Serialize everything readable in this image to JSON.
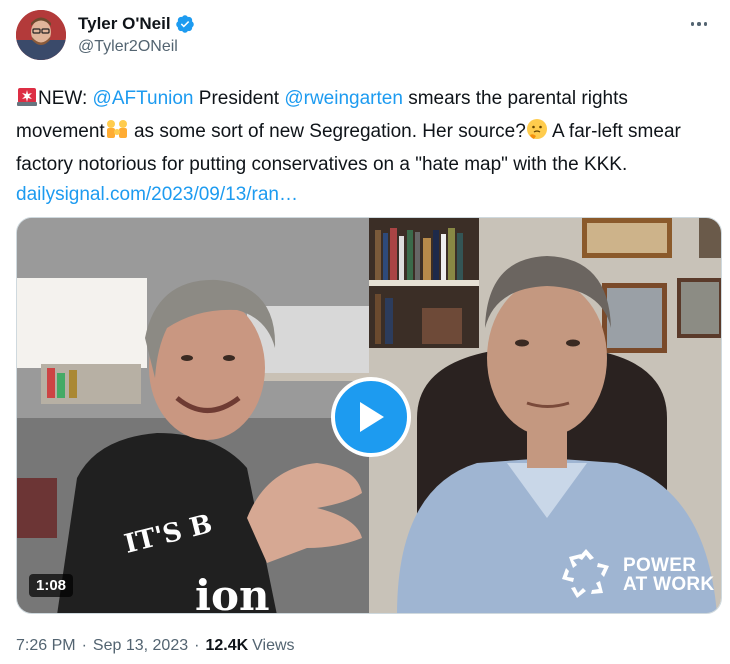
{
  "author": {
    "display_name": "Tyler O'Neil",
    "handle": "@Tyler2ONeil",
    "verified": true,
    "avatar_icon": "profile-photo"
  },
  "more_icon": "ellipsis-icon",
  "tweet": {
    "segments": [
      {
        "type": "emoji",
        "icon": "rotating-light-icon"
      },
      {
        "type": "text",
        "text": "NEW: "
      },
      {
        "type": "link",
        "text": "@AFTunion"
      },
      {
        "type": "text",
        "text": " President "
      },
      {
        "type": "link",
        "text": "@rweingarten"
      },
      {
        "type": "text",
        "text": " smears the parental rights movement"
      },
      {
        "type": "emoji",
        "icon": "family-icon"
      },
      {
        "type": "text",
        "text": " as some sort of new Segregation. Her source?"
      },
      {
        "type": "emoji",
        "icon": "thinking-face-icon"
      },
      {
        "type": "text",
        "text": " A far-left smear factory notorious for putting conservatives on a \"hate map\" with the KKK. "
      },
      {
        "type": "link",
        "text": "dailysignal.com/2023/09/13/ran…"
      }
    ]
  },
  "media": {
    "duration": "1:08",
    "play_icon": "play-icon",
    "watermark_line1": "POWER",
    "watermark_line2": "AT WORK",
    "shirt_text_1": "IT'S B",
    "shirt_text_2": "ion"
  },
  "meta": {
    "time": "7:26 PM",
    "separator": "·",
    "date": "Sep 13, 2023",
    "views_count": "12.4K",
    "views_label": "Views"
  },
  "colors": {
    "accent": "#1d9bf0",
    "text": "#0f1419",
    "secondary": "#536471"
  }
}
